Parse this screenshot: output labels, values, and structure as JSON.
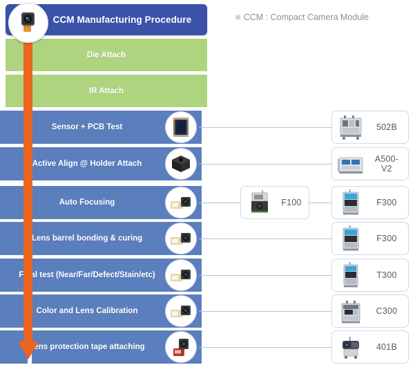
{
  "note": {
    "symbol": "※",
    "text": "CCM : Compact Camera Module"
  },
  "colors": {
    "header_blue": "#3a52a8",
    "row_green": "#aed47f",
    "row_blue": "#5b7ebd",
    "arrow_orange": "#ea6520",
    "connector": "#aec4df",
    "box_border": "#cdd9ea",
    "label_text": "#ffffff",
    "equipment_text": "#555a60",
    "note_text": "#8a8f96"
  },
  "flow": {
    "header": {
      "label": "CCM Manufacturing Procedure",
      "icon": "camera-module-icon"
    },
    "steps": [
      {
        "label": "Die Attach",
        "type": "green",
        "thumb": null
      },
      {
        "label": "IR Attach",
        "type": "green",
        "thumb": null
      },
      {
        "label": "Sensor + PCB Test",
        "type": "blue",
        "thumb": "sensor-pcb-thumb"
      },
      {
        "label": "Active Align @ Holder Attach",
        "type": "blue",
        "thumb": "holder-module-thumb"
      },
      {
        "label": "Auto Focusing",
        "type": "blue",
        "thumb": "camera-module-thumb"
      },
      {
        "label": "Lens barrel bonding & curing",
        "type": "blue",
        "thumb": "camera-module-thumb"
      },
      {
        "label": "Final test (Near/Far/Defect/Stain/etc)",
        "type": "blue",
        "thumb": "camera-module-thumb"
      },
      {
        "label": "Color and Lens Calibration",
        "type": "blue",
        "thumb": "camera-module-thumb"
      },
      {
        "label": "Lens protection tape attaching",
        "type": "blue",
        "thumb": "tape-module-thumb"
      }
    ]
  },
  "equipment": {
    "middle": [
      {
        "name": "F100",
        "icon": "machine-f100-icon"
      }
    ],
    "right": [
      {
        "name": "502B",
        "icon": "machine-502b-icon"
      },
      {
        "name": "A500-V2",
        "icon": "machine-a500v2-icon"
      },
      {
        "name": "F300",
        "icon": "machine-f300-icon"
      },
      {
        "name": "F300",
        "icon": "machine-f300-icon"
      },
      {
        "name": "T300",
        "icon": "machine-t300-icon"
      },
      {
        "name": "C300",
        "icon": "machine-c300-icon"
      },
      {
        "name": "401B",
        "icon": "machine-401b-icon"
      }
    ]
  }
}
